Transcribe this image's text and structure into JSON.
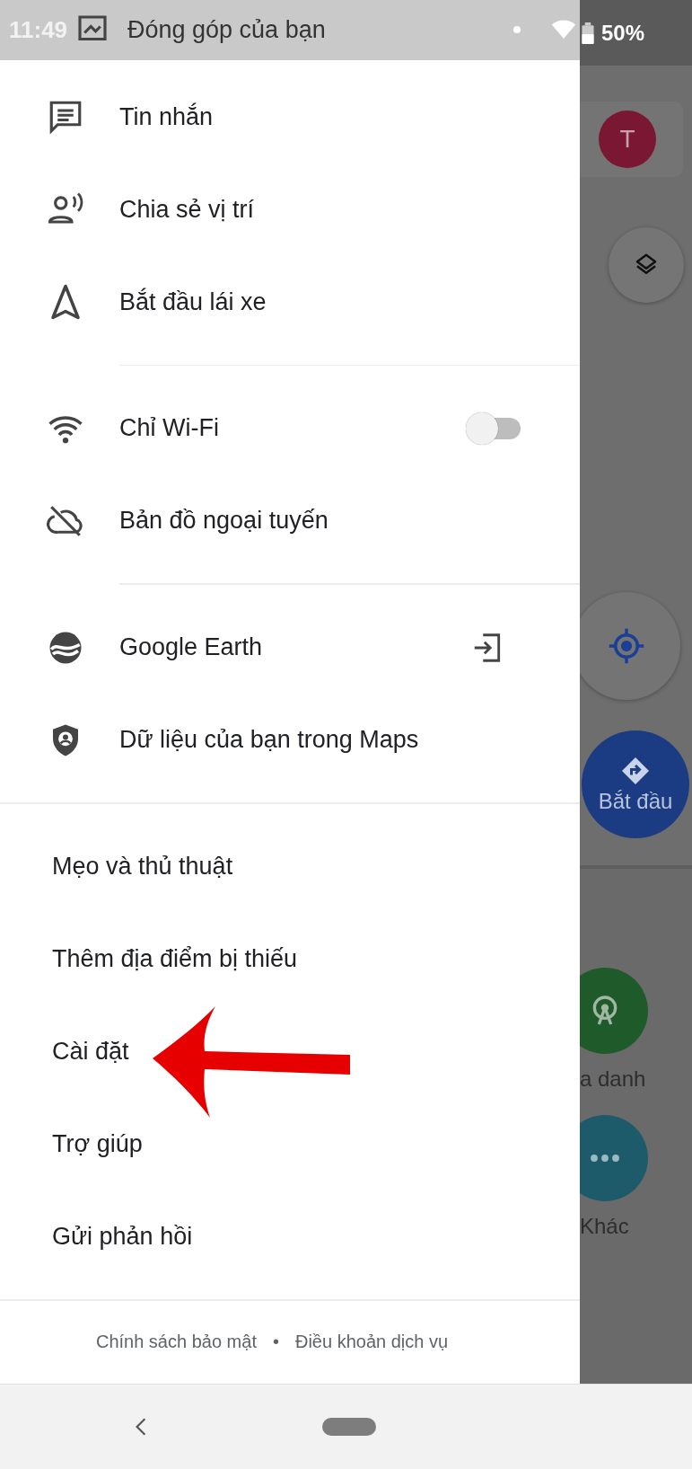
{
  "status_bar": {
    "time": "11:49",
    "battery": "50%"
  },
  "drawer": {
    "scrolled_item": {
      "label": "Đóng góp của bạn"
    },
    "sections": [
      {
        "kind": "icon",
        "items": [
          {
            "label": "Tin nhắn",
            "kind": "plain"
          },
          {
            "label": "Chia sẻ vị trí",
            "kind": "plain"
          },
          {
            "label": "Bắt đầu lái xe",
            "kind": "plain"
          }
        ]
      },
      {
        "kind": "icon",
        "items": [
          {
            "label": "Chỉ Wi-Fi",
            "kind": "toggle",
            "on": false
          },
          {
            "label": "Bản đồ ngoại tuyến",
            "kind": "plain"
          }
        ]
      },
      {
        "kind": "icon",
        "items": [
          {
            "label": "Google Earth",
            "kind": "external"
          },
          {
            "label": "Dữ liệu của bạn trong Maps",
            "kind": "plain"
          }
        ]
      },
      {
        "kind": "text",
        "items": [
          {
            "label": "Mẹo và thủ thuật",
            "kind": "plain"
          },
          {
            "label": "Thêm địa điểm bị thiếu",
            "kind": "plain"
          },
          {
            "label": "Cài đặt",
            "kind": "plain"
          },
          {
            "label": "Trợ giúp",
            "kind": "plain"
          },
          {
            "label": "Gửi phản hồi",
            "kind": "plain"
          }
        ]
      }
    ],
    "footer": {
      "links": [
        "Chính sách bảo mật",
        "Điều khoản dịch vụ"
      ],
      "separator": "•"
    }
  },
  "map": {
    "avatar_letter": "T",
    "start_label": "Bắt đầu",
    "category_labels": [
      "a danh",
      "Khác"
    ]
  }
}
